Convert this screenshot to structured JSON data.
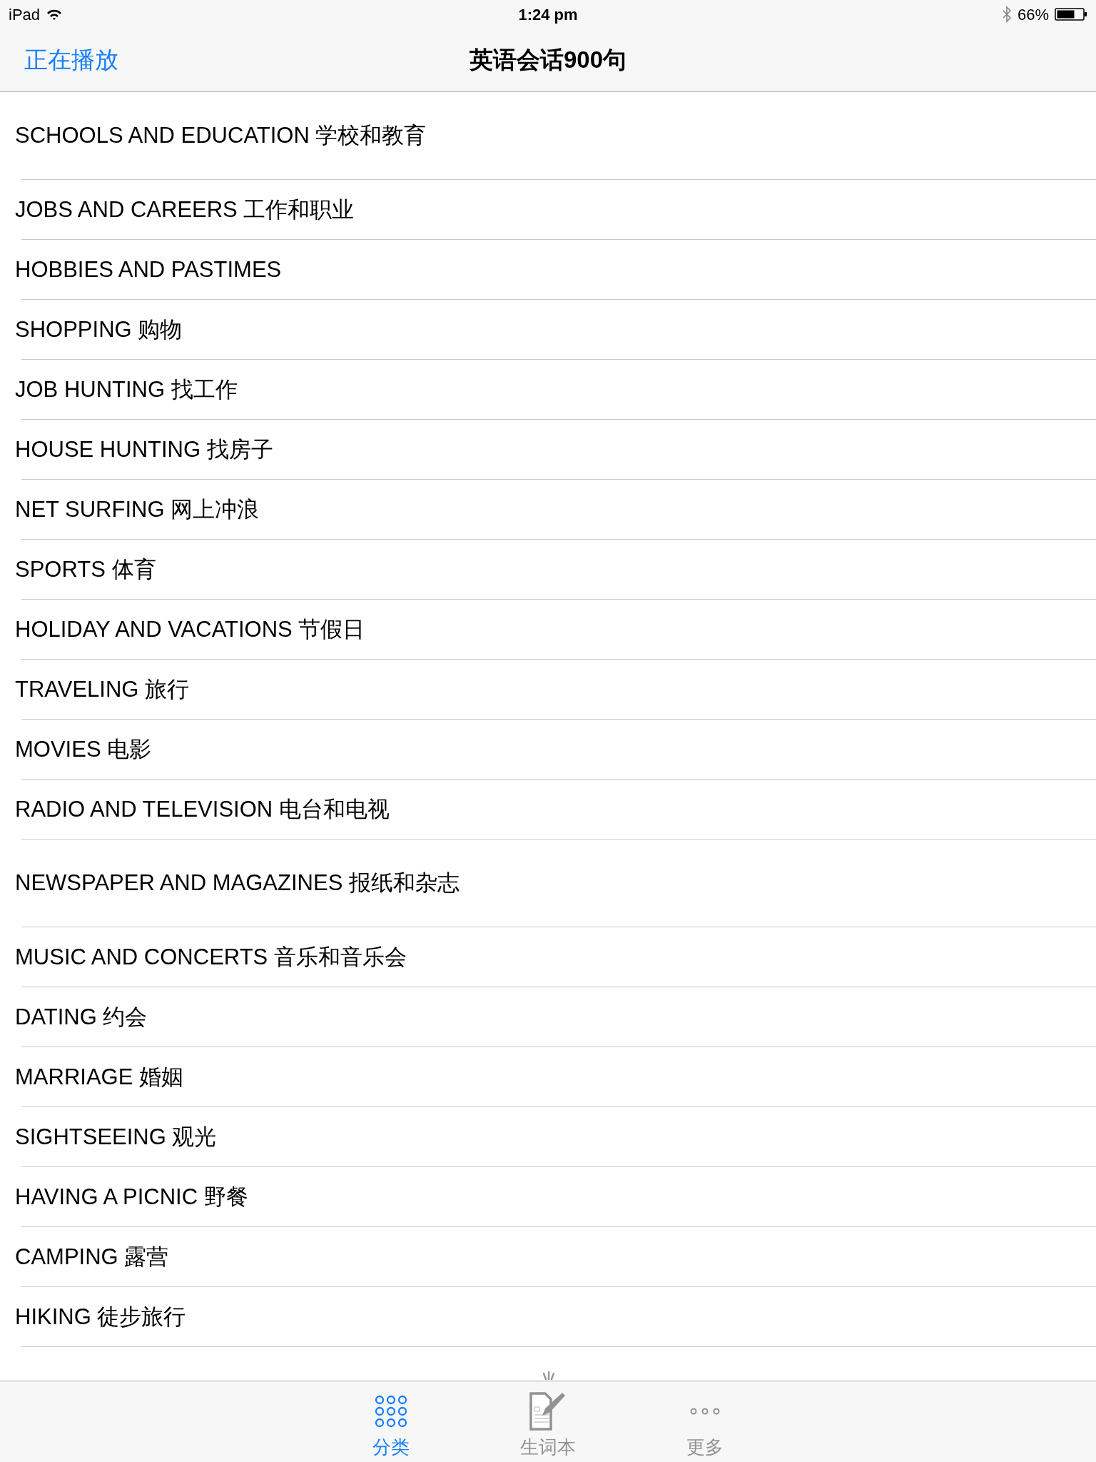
{
  "status_bar": {
    "device": "iPad",
    "time": "1:24 pm",
    "battery": "66%"
  },
  "nav_bar": {
    "back": "正在播放",
    "title": "英语会话900句"
  },
  "topics": [
    "SCHOOLS AND EDUCATION 学校和教育",
    "JOBS AND CAREERS 工作和职业",
    "HOBBIES AND PASTIMES",
    "SHOPPING 购物",
    "JOB HUNTING 找工作",
    "HOUSE HUNTING 找房子",
    "NET SURFING 网上冲浪",
    "SPORTS 体育",
    "HOLIDAY AND VACATIONS 节假日",
    "TRAVELING 旅行",
    "MOVIES 电影",
    "RADIO AND TELEVISION 电台和电视",
    "NEWSPAPER AND MAGAZINES 报纸和杂志",
    "MUSIC AND CONCERTS 音乐和音乐会",
    "DATING 约会",
    "MARRIAGE 婚姻",
    "SIGHTSEEING 观光",
    "HAVING A PICNIC 野餐",
    "CAMPING 露营",
    "HIKING 徒步旅行"
  ],
  "tab_bar": [
    {
      "kind": "grid",
      "label": "分类",
      "selected": true
    },
    {
      "kind": "notebook",
      "label": "生词本",
      "selected": false
    },
    {
      "kind": "more",
      "label": "更多",
      "selected": false
    }
  ]
}
